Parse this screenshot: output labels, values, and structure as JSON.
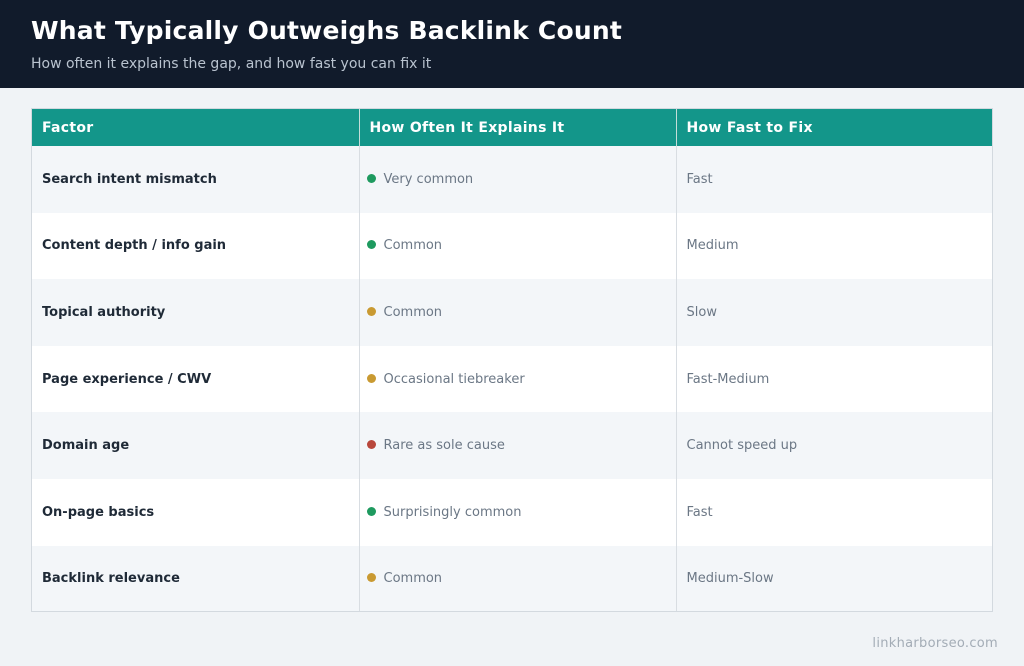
{
  "header": {
    "title": "What Typically Outweighs Backlink Count",
    "subtitle": "How often it explains the gap, and how fast you can fix it"
  },
  "table": {
    "columns": [
      "Factor",
      "How Often It Explains It",
      "How Fast to Fix"
    ],
    "rows": [
      {
        "factor": "Search intent mismatch",
        "often": "Very common",
        "status": "green",
        "fix": "Fast"
      },
      {
        "factor": "Content depth / info gain",
        "often": "Common",
        "status": "green",
        "fix": "Medium"
      },
      {
        "factor": "Topical authority",
        "often": "Common",
        "status": "amber",
        "fix": "Slow"
      },
      {
        "factor": "Page experience / CWV",
        "often": "Occasional tiebreaker",
        "status": "amber",
        "fix": "Fast-Medium"
      },
      {
        "factor": "Domain age",
        "often": "Rare as sole cause",
        "status": "red",
        "fix": "Cannot speed up"
      },
      {
        "factor": "On-page basics",
        "often": "Surprisingly common",
        "status": "green",
        "fix": "Fast"
      },
      {
        "factor": "Backlink relevance",
        "often": "Common",
        "status": "amber",
        "fix": "Medium-Slow"
      }
    ]
  },
  "status_colors": {
    "green": "#1e9a5f",
    "amber": "#c99a32",
    "red": "#b8473c"
  },
  "colors": {
    "header_bg": "#111b2b",
    "table_header_bg": "#13968a"
  },
  "footer": {
    "source": "linkharborseo.com"
  }
}
